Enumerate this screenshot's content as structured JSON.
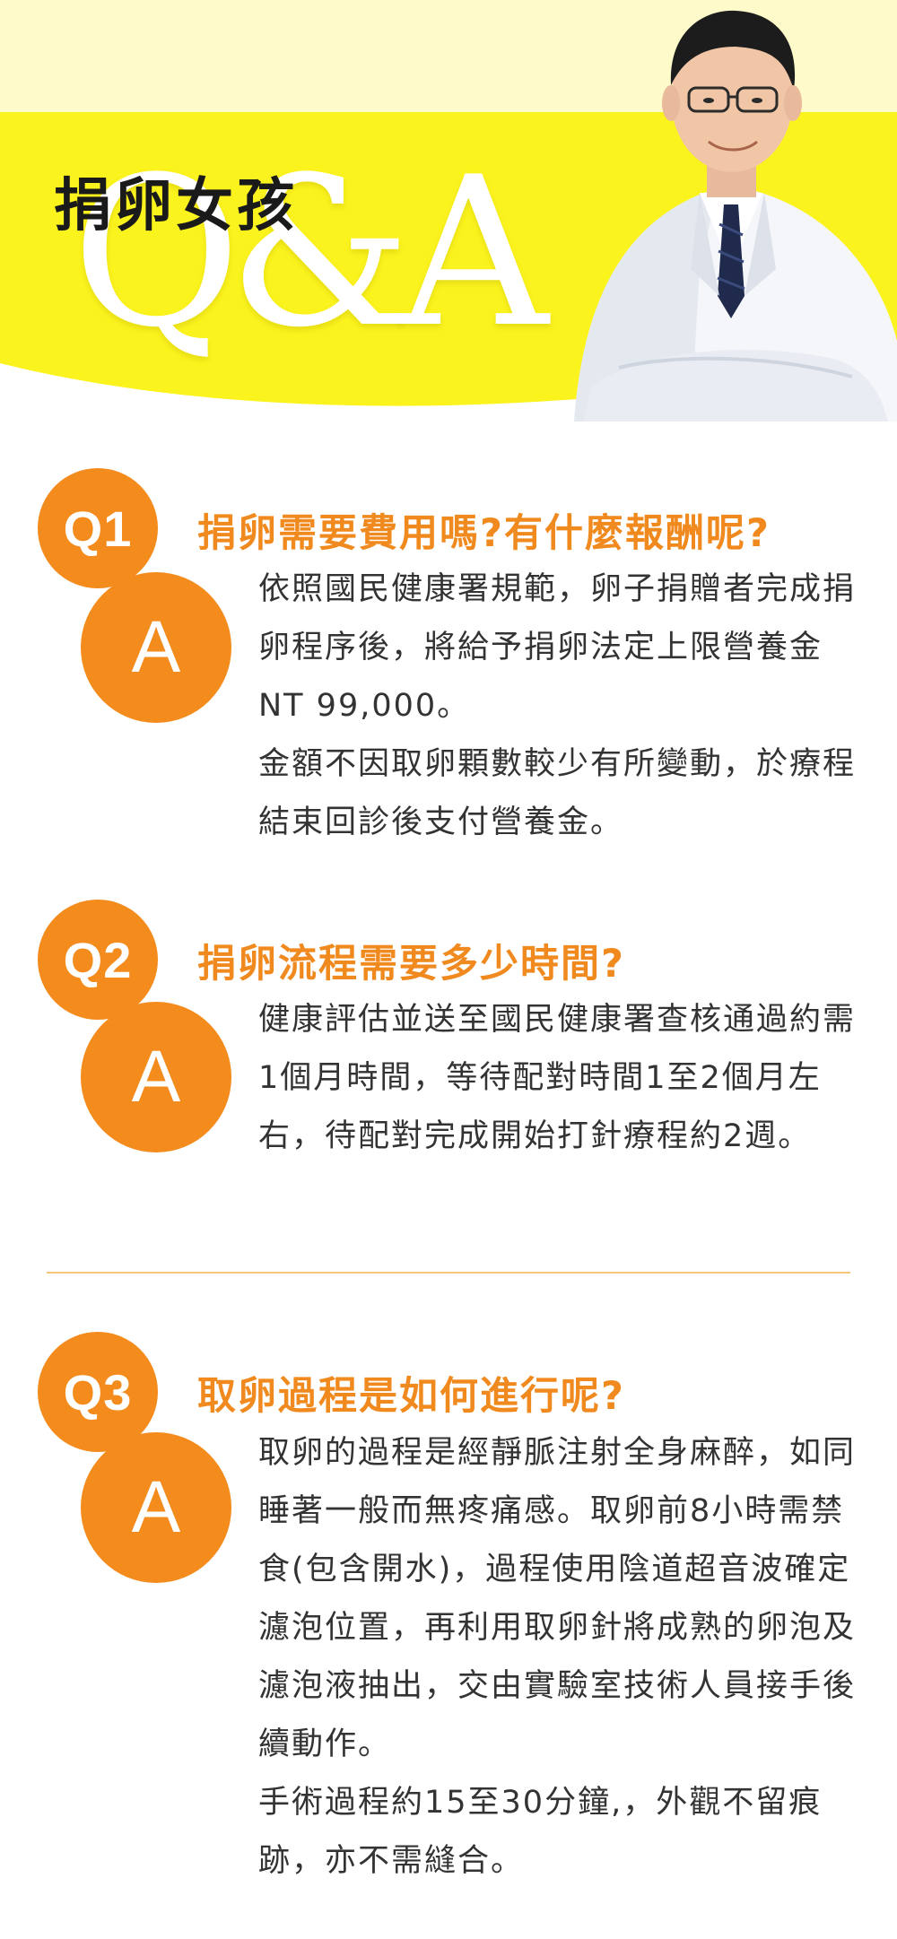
{
  "header": {
    "title": "捐卵女孩",
    "qa_art": "Q&A",
    "doctor_image": "doctor-portrait"
  },
  "colors": {
    "accent_orange": "#f38b1d",
    "header_yellow": "#fbf31d",
    "header_pale": "#fefac9",
    "body_text": "#333333"
  },
  "qa": [
    {
      "q_label": "Q1",
      "a_label": "A",
      "question": "捐卵需要費用嗎?有什麼報酬呢?",
      "answer_lines": [
        "依照國民健康署規範，卵子捐贈者完成捐卵程序後，將給予捐卵法定上限營養金 NT 99,000。",
        "金額不因取卵顆數較少有所變動，於療程結束回診後支付營養金。"
      ]
    },
    {
      "q_label": "Q2",
      "a_label": "A",
      "question": "捐卵流程需要多少時間?",
      "answer_lines": [
        "健康評估並送至國民健康署查核通過約需1個月時間，等待配對時間1至2個月左右，待配對完成開始打針療程約2週。"
      ]
    },
    {
      "q_label": "Q3",
      "a_label": "A",
      "question": "取卵過程是如何進行呢?",
      "answer_lines": [
        "取卵的過程是經靜脈注射全身麻醉，如同睡著一般而無疼痛感。取卵前8小時需禁食(包含開水)，過程使用陰道超音波確定濾泡位置，再利用取卵針將成熟的卵泡及濾泡液抽出，交由實驗室技術人員接手後續動作。",
        "手術過程約15至30分鐘,，外觀不留痕跡，亦不需縫合。"
      ]
    }
  ]
}
